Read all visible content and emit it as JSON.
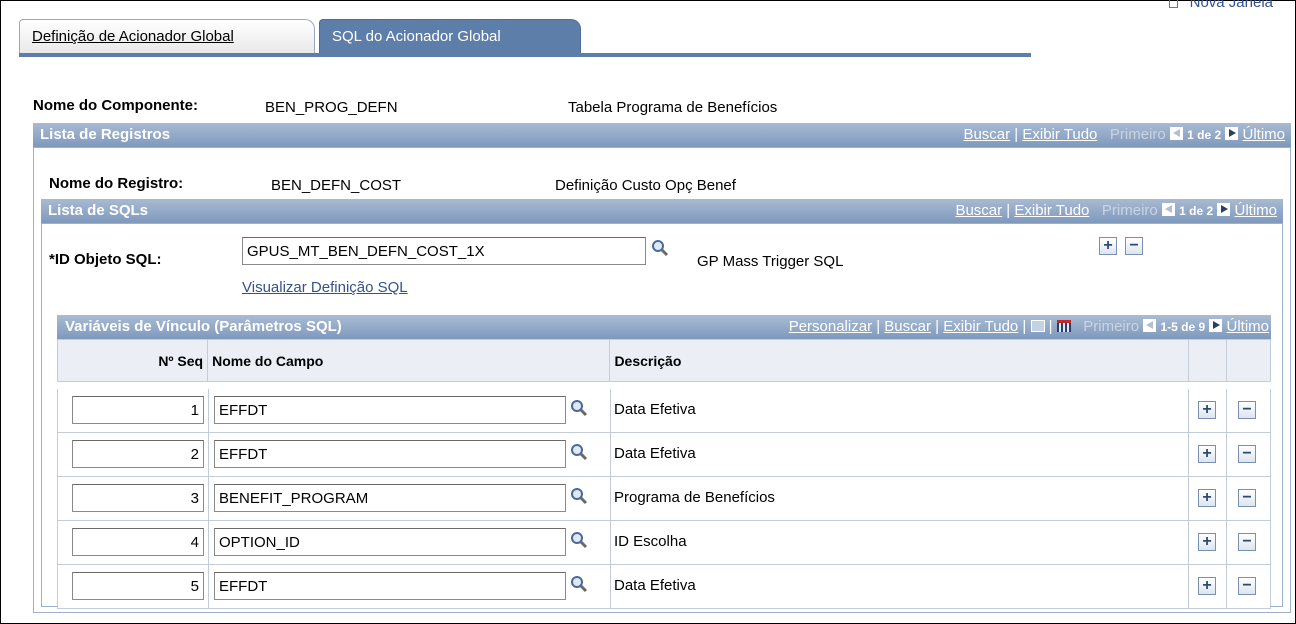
{
  "top_link": "Nova Janela",
  "tabs": [
    {
      "label": "Definição de Acionador Global"
    },
    {
      "label": "SQL do Acionador Global"
    }
  ],
  "component": {
    "label": "Nome do Componente:",
    "name": "BEN_PROG_DEFN",
    "description": "Tabela Programa de Benefícios"
  },
  "records": {
    "title": "Lista de Registros",
    "find": "Buscar",
    "view_all": "Exibir Tudo",
    "first": "Primeiro",
    "count": "1 de 2",
    "last": "Último",
    "record_label": "Nome do Registro:",
    "record_name": "BEN_DEFN_COST",
    "record_desc": "Definição Custo Opç Benef"
  },
  "sqls": {
    "title": "Lista de SQLs",
    "find": "Buscar",
    "view_all": "Exibir Tudo",
    "first": "Primeiro",
    "count": "1 de 2",
    "last": "Último",
    "sql_id_label": "*ID Objeto SQL:",
    "sql_id_value": "GPUS_MT_BEN_DEFN_COST_1X",
    "sql_desc": "GP Mass Trigger SQL",
    "view_sql_link": "Visualizar Definição SQL"
  },
  "bind_vars": {
    "title": "Variáveis de Vínculo (Parâmetros SQL)",
    "personalize": "Personalizar",
    "find": "Buscar",
    "view_all": "Exibir Tudo",
    "first": "Primeiro",
    "count": "1-5 de 9",
    "last": "Último",
    "columns": {
      "seq": "Nº Seq",
      "field": "Nome do Campo",
      "desc": "Descrição"
    },
    "rows": [
      {
        "seq": "1",
        "field": "EFFDT",
        "desc": "Data Efetiva"
      },
      {
        "seq": "2",
        "field": "EFFDT",
        "desc": "Data Efetiva"
      },
      {
        "seq": "3",
        "field": "BENEFIT_PROGRAM",
        "desc": "Programa de Benefícios"
      },
      {
        "seq": "4",
        "field": "OPTION_ID",
        "desc": "ID Escolha"
      },
      {
        "seq": "5",
        "field": "EFFDT",
        "desc": "Data Efetiva"
      }
    ]
  },
  "icons": {
    "lookup": "magnifier-icon",
    "add": "plus-icon",
    "delete": "minus-icon"
  }
}
